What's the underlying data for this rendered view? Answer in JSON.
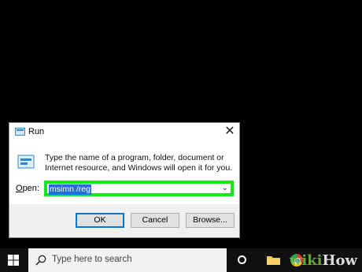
{
  "dialog": {
    "title": "Run",
    "close_glyph": "✕",
    "description": "Type the name of a program, folder, document or Internet resource, and Windows will open it for you.",
    "open_label_pre": "",
    "open_label_underline": "O",
    "open_label_post": "pen:",
    "open_value": "msimn /reg",
    "ok_label": "OK",
    "cancel_label": "Cancel",
    "browse_label": "Browse..."
  },
  "taskbar": {
    "search_placeholder": "Type here to search"
  },
  "watermark": {
    "part1": "wiki",
    "part2": "How"
  },
  "colors": {
    "highlight": "#22e01b",
    "selection": "#1d6ee0"
  },
  "icons": [
    "run-app-icon",
    "close-icon",
    "windows-start-icon",
    "search-icon",
    "cortana-icon",
    "file-explorer-icon",
    "chrome-icon"
  ]
}
